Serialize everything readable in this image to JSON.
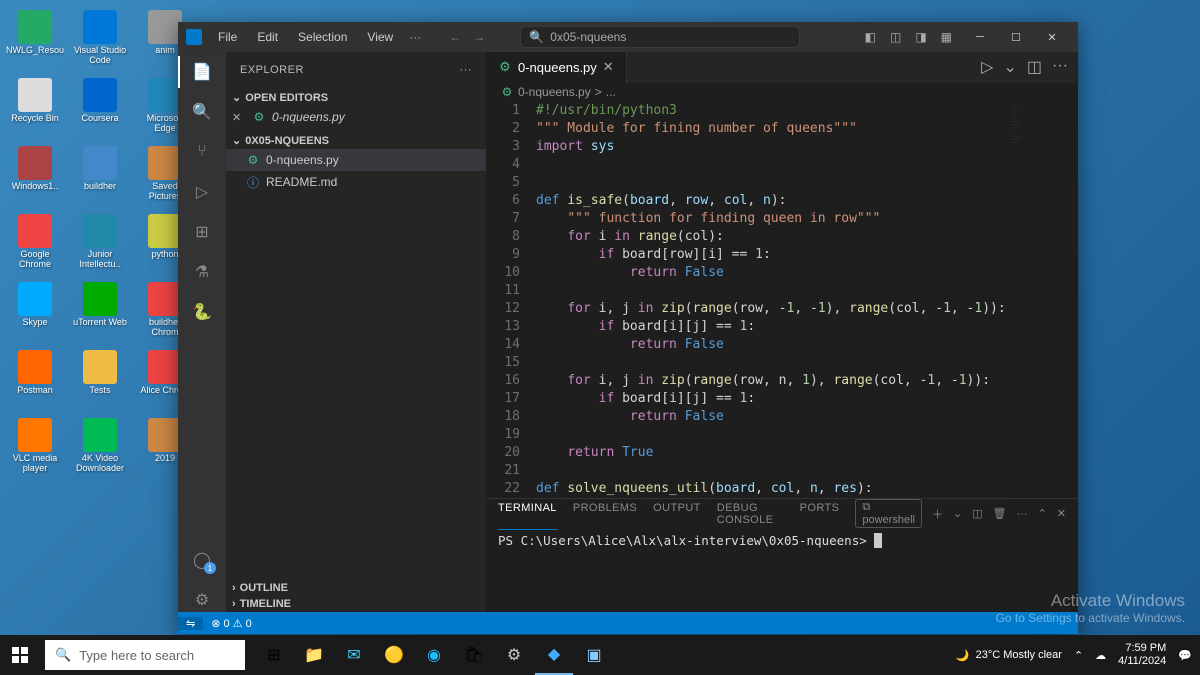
{
  "desktop_icons": [
    [
      {
        "label": "NWLG_Resources",
        "color": "#2a6"
      },
      {
        "label": "Visual Studio Code",
        "color": "#0078d7"
      },
      {
        "label": "anim",
        "color": "#999"
      }
    ],
    [
      {
        "label": "Recycle Bin",
        "color": "#ddd"
      },
      {
        "label": "Coursera",
        "color": "#06c"
      },
      {
        "label": "Microsoft Edge",
        "color": "#28b"
      }
    ],
    [
      {
        "label": "Windows1..",
        "color": "#a44"
      },
      {
        "label": "buildher",
        "color": "#48c"
      },
      {
        "label": "Saved Pictures",
        "color": "#c84"
      }
    ],
    [
      {
        "label": "Google Chrome",
        "color": "#e44"
      },
      {
        "label": "Junior Intellectu..",
        "color": "#28a"
      },
      {
        "label": "python",
        "color": "#cc4"
      }
    ],
    [
      {
        "label": "Skype",
        "color": "#0af"
      },
      {
        "label": "uTorrent Web",
        "color": "#0a0"
      },
      {
        "label": "buildher Chrom",
        "color": "#e44"
      }
    ],
    [
      {
        "label": "Postman",
        "color": "#f60"
      },
      {
        "label": "Tests",
        "color": "#eb4"
      },
      {
        "label": "Alice Chrom",
        "color": "#e44"
      }
    ],
    [
      {
        "label": "VLC media player",
        "color": "#f70"
      },
      {
        "label": "4K Video Downloader",
        "color": "#0b5"
      },
      {
        "label": "2019",
        "color": "#c84"
      }
    ]
  ],
  "vscode": {
    "menus": [
      "File",
      "Edit",
      "Selection",
      "View"
    ],
    "menu_ellipsis": "···",
    "search_placeholder": "0x05-nqueens",
    "sidebar": {
      "title": "EXPLORER",
      "open_editors": "OPEN EDITORS",
      "folder": "0X05-NQUEENS",
      "open_file": "0-nqueens.py",
      "files": [
        {
          "name": "0-nqueens.py",
          "active": true,
          "icon": "py"
        },
        {
          "name": "README.md",
          "active": false,
          "icon": "info"
        }
      ],
      "outline": "OUTLINE",
      "timeline": "TIMELINE"
    },
    "tab": {
      "name": "0-nqueens.py"
    },
    "breadcrumb": {
      "file": "0-nqueens.py",
      "sep": ">",
      "more": "..."
    },
    "code_lines": [
      {
        "n": 1,
        "html": "<span class='cm'>#!/usr/bin/python3</span>"
      },
      {
        "n": 2,
        "html": "<span class='str'>\"\"\" Module for fining number of queens\"\"\"</span>"
      },
      {
        "n": 3,
        "html": "<span class='kw'>import</span> <span class='pa'>sys</span>"
      },
      {
        "n": 4,
        "html": ""
      },
      {
        "n": 5,
        "html": ""
      },
      {
        "n": 6,
        "html": "<span class='bl'>def</span> <span class='fn'>is_safe</span>(<span class='pa'>board</span>, <span class='pa'>row</span>, <span class='pa'>col</span>, <span class='pa'>n</span>):"
      },
      {
        "n": 7,
        "html": "    <span class='str'>\"\"\" function for finding queen in row\"\"\"</span>"
      },
      {
        "n": 8,
        "html": "    <span class='kw'>for</span> i <span class='kw'>in</span> <span class='fn'>range</span>(col):"
      },
      {
        "n": 9,
        "html": "        <span class='kw'>if</span> board[row][i] == <span class='num'>1</span>:"
      },
      {
        "n": 10,
        "html": "            <span class='kw'>return</span> <span class='bl'>False</span>"
      },
      {
        "n": 11,
        "html": ""
      },
      {
        "n": 12,
        "html": "    <span class='kw'>for</span> i, j <span class='kw'>in</span> <span class='fn'>zip</span>(<span class='fn'>range</span>(row, -<span class='num'>1</span>, -<span class='num'>1</span>), <span class='fn'>range</span>(col, -<span class='num'>1</span>, -<span class='num'>1</span>)):"
      },
      {
        "n": 13,
        "html": "        <span class='kw'>if</span> board[i][j] == <span class='num'>1</span>:"
      },
      {
        "n": 14,
        "html": "            <span class='kw'>return</span> <span class='bl'>False</span>"
      },
      {
        "n": 15,
        "html": ""
      },
      {
        "n": 16,
        "html": "    <span class='kw'>for</span> i, j <span class='kw'>in</span> <span class='fn'>zip</span>(<span class='fn'>range</span>(row, n, <span class='num'>1</span>), <span class='fn'>range</span>(col, -<span class='num'>1</span>, -<span class='num'>1</span>)):"
      },
      {
        "n": 17,
        "html": "        <span class='kw'>if</span> board[i][j] == <span class='num'>1</span>:"
      },
      {
        "n": 18,
        "html": "            <span class='kw'>return</span> <span class='bl'>False</span>"
      },
      {
        "n": 19,
        "html": ""
      },
      {
        "n": 20,
        "html": "    <span class='kw'>return</span> <span class='bl'>True</span>"
      },
      {
        "n": 21,
        "html": ""
      },
      {
        "n": 22,
        "html": "<span class='bl'>def</span> <span class='fn'>solve_nqueens_util</span>(<span class='pa'>board</span>, <span class='pa'>col</span>, <span class='pa'>n</span>, <span class='pa'>res</span>):"
      }
    ],
    "terminal": {
      "tabs": [
        "TERMINAL",
        "PROBLEMS",
        "OUTPUT",
        "DEBUG CONSOLE",
        "PORTS"
      ],
      "shell": "powershell",
      "prompt": "PS C:\\Users\\Alice\\Alx\\alx-interview\\0x05-nqueens> "
    },
    "statusbar": {
      "badge": "1"
    }
  },
  "activate": {
    "t1": "Activate Windows",
    "t2": "Go to Settings to activate Windows."
  },
  "taskbar": {
    "search_placeholder": "Type here to search",
    "weather": "23°C  Mostly clear",
    "time": "7:59 PM",
    "date": "4/11/2024"
  }
}
